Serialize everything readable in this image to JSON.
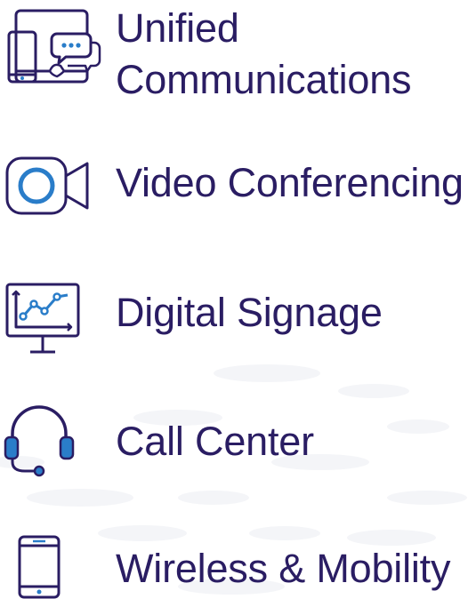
{
  "items": [
    {
      "icon": "devices-chat-icon",
      "label_line1": "Unified",
      "label_line2": "Communications"
    },
    {
      "icon": "video-camera-icon",
      "label": "Video Conferencing"
    },
    {
      "icon": "monitor-chart-icon",
      "label": "Digital Signage"
    },
    {
      "icon": "headset-icon",
      "label": "Call Center"
    },
    {
      "icon": "smartphone-icon",
      "label": "Wireless & Mobility"
    }
  ],
  "colors": {
    "text": "#2a1d63",
    "icon_outline": "#2a1d63",
    "accent_blue": "#2a7dc9"
  }
}
